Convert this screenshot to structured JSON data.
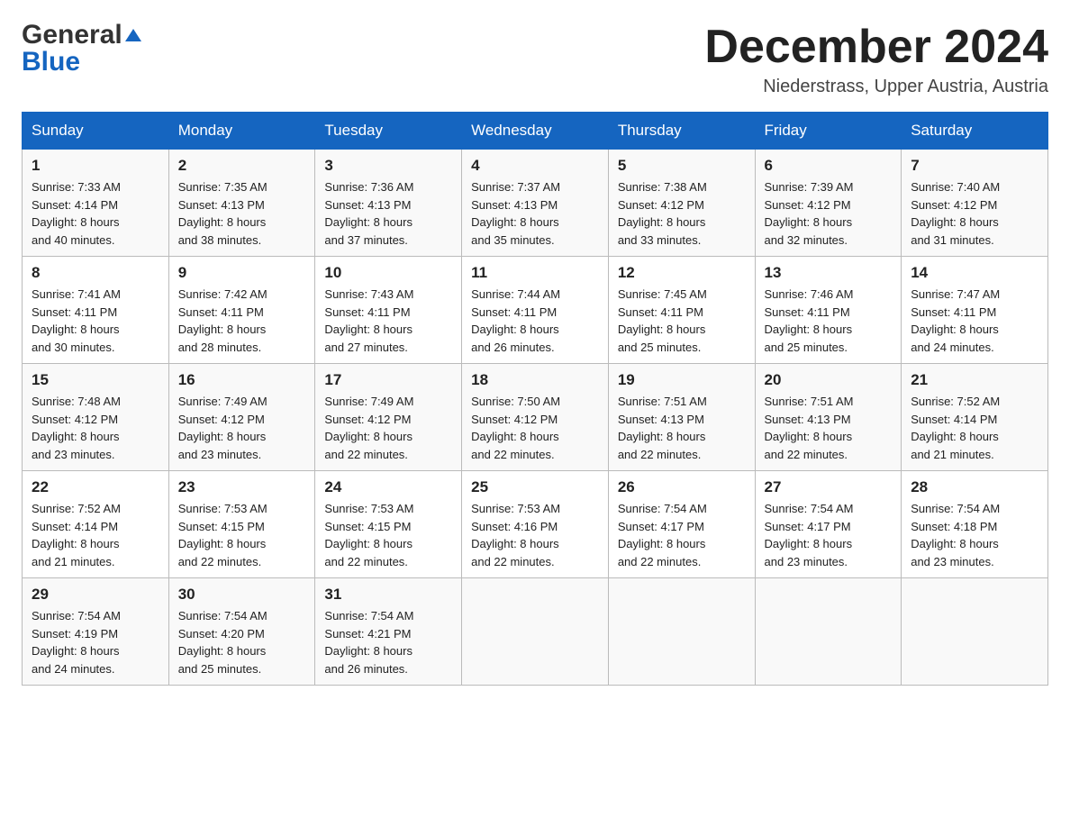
{
  "header": {
    "logo_general": "General",
    "logo_blue": "Blue",
    "month_title": "December 2024",
    "location": "Niederstrass, Upper Austria, Austria"
  },
  "weekdays": [
    "Sunday",
    "Monday",
    "Tuesday",
    "Wednesday",
    "Thursday",
    "Friday",
    "Saturday"
  ],
  "weeks": [
    [
      {
        "day": "1",
        "sunrise": "7:33 AM",
        "sunset": "4:14 PM",
        "daylight": "8 hours and 40 minutes."
      },
      {
        "day": "2",
        "sunrise": "7:35 AM",
        "sunset": "4:13 PM",
        "daylight": "8 hours and 38 minutes."
      },
      {
        "day": "3",
        "sunrise": "7:36 AM",
        "sunset": "4:13 PM",
        "daylight": "8 hours and 37 minutes."
      },
      {
        "day": "4",
        "sunrise": "7:37 AM",
        "sunset": "4:13 PM",
        "daylight": "8 hours and 35 minutes."
      },
      {
        "day": "5",
        "sunrise": "7:38 AM",
        "sunset": "4:12 PM",
        "daylight": "8 hours and 33 minutes."
      },
      {
        "day": "6",
        "sunrise": "7:39 AM",
        "sunset": "4:12 PM",
        "daylight": "8 hours and 32 minutes."
      },
      {
        "day": "7",
        "sunrise": "7:40 AM",
        "sunset": "4:12 PM",
        "daylight": "8 hours and 31 minutes."
      }
    ],
    [
      {
        "day": "8",
        "sunrise": "7:41 AM",
        "sunset": "4:11 PM",
        "daylight": "8 hours and 30 minutes."
      },
      {
        "day": "9",
        "sunrise": "7:42 AM",
        "sunset": "4:11 PM",
        "daylight": "8 hours and 28 minutes."
      },
      {
        "day": "10",
        "sunrise": "7:43 AM",
        "sunset": "4:11 PM",
        "daylight": "8 hours and 27 minutes."
      },
      {
        "day": "11",
        "sunrise": "7:44 AM",
        "sunset": "4:11 PM",
        "daylight": "8 hours and 26 minutes."
      },
      {
        "day": "12",
        "sunrise": "7:45 AM",
        "sunset": "4:11 PM",
        "daylight": "8 hours and 25 minutes."
      },
      {
        "day": "13",
        "sunrise": "7:46 AM",
        "sunset": "4:11 PM",
        "daylight": "8 hours and 25 minutes."
      },
      {
        "day": "14",
        "sunrise": "7:47 AM",
        "sunset": "4:11 PM",
        "daylight": "8 hours and 24 minutes."
      }
    ],
    [
      {
        "day": "15",
        "sunrise": "7:48 AM",
        "sunset": "4:12 PM",
        "daylight": "8 hours and 23 minutes."
      },
      {
        "day": "16",
        "sunrise": "7:49 AM",
        "sunset": "4:12 PM",
        "daylight": "8 hours and 23 minutes."
      },
      {
        "day": "17",
        "sunrise": "7:49 AM",
        "sunset": "4:12 PM",
        "daylight": "8 hours and 22 minutes."
      },
      {
        "day": "18",
        "sunrise": "7:50 AM",
        "sunset": "4:12 PM",
        "daylight": "8 hours and 22 minutes."
      },
      {
        "day": "19",
        "sunrise": "7:51 AM",
        "sunset": "4:13 PM",
        "daylight": "8 hours and 22 minutes."
      },
      {
        "day": "20",
        "sunrise": "7:51 AM",
        "sunset": "4:13 PM",
        "daylight": "8 hours and 22 minutes."
      },
      {
        "day": "21",
        "sunrise": "7:52 AM",
        "sunset": "4:14 PM",
        "daylight": "8 hours and 21 minutes."
      }
    ],
    [
      {
        "day": "22",
        "sunrise": "7:52 AM",
        "sunset": "4:14 PM",
        "daylight": "8 hours and 21 minutes."
      },
      {
        "day": "23",
        "sunrise": "7:53 AM",
        "sunset": "4:15 PM",
        "daylight": "8 hours and 22 minutes."
      },
      {
        "day": "24",
        "sunrise": "7:53 AM",
        "sunset": "4:15 PM",
        "daylight": "8 hours and 22 minutes."
      },
      {
        "day": "25",
        "sunrise": "7:53 AM",
        "sunset": "4:16 PM",
        "daylight": "8 hours and 22 minutes."
      },
      {
        "day": "26",
        "sunrise": "7:54 AM",
        "sunset": "4:17 PM",
        "daylight": "8 hours and 22 minutes."
      },
      {
        "day": "27",
        "sunrise": "7:54 AM",
        "sunset": "4:17 PM",
        "daylight": "8 hours and 23 minutes."
      },
      {
        "day": "28",
        "sunrise": "7:54 AM",
        "sunset": "4:18 PM",
        "daylight": "8 hours and 23 minutes."
      }
    ],
    [
      {
        "day": "29",
        "sunrise": "7:54 AM",
        "sunset": "4:19 PM",
        "daylight": "8 hours and 24 minutes."
      },
      {
        "day": "30",
        "sunrise": "7:54 AM",
        "sunset": "4:20 PM",
        "daylight": "8 hours and 25 minutes."
      },
      {
        "day": "31",
        "sunrise": "7:54 AM",
        "sunset": "4:21 PM",
        "daylight": "8 hours and 26 minutes."
      },
      null,
      null,
      null,
      null
    ]
  ],
  "labels": {
    "sunrise": "Sunrise:",
    "sunset": "Sunset:",
    "daylight": "Daylight:"
  }
}
